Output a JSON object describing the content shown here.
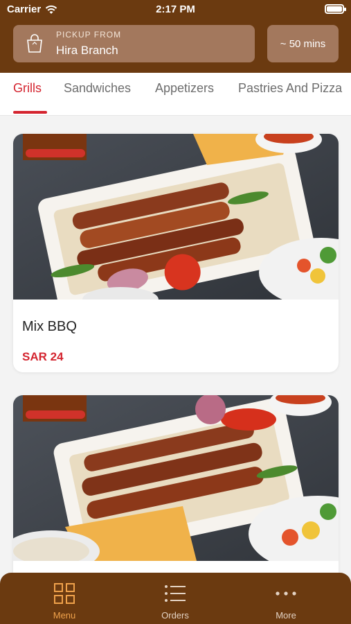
{
  "status_bar": {
    "carrier": "Carrier",
    "time": "2:17 PM"
  },
  "header": {
    "pickup_label": "PICKUP FROM",
    "branch": "Hira Branch",
    "eta": "~ 50 mins"
  },
  "tabs": [
    {
      "label": "Grills",
      "active": true
    },
    {
      "label": "Sandwiches",
      "active": false
    },
    {
      "label": "Appetizers",
      "active": false
    },
    {
      "label": "Pastries And Pizza",
      "active": false
    }
  ],
  "items": [
    {
      "name": "Mix BBQ",
      "price": "SAR 24"
    }
  ],
  "bottom_nav": [
    {
      "label": "Menu",
      "icon": "grid-icon",
      "active": true
    },
    {
      "label": "Orders",
      "icon": "list-icon",
      "active": false
    },
    {
      "label": "More",
      "icon": "more-dots-icon",
      "active": false
    }
  ],
  "colors": {
    "brand_brown": "#6b3a10",
    "accent_red": "#d4242f",
    "active_nav": "#f0a24b"
  }
}
